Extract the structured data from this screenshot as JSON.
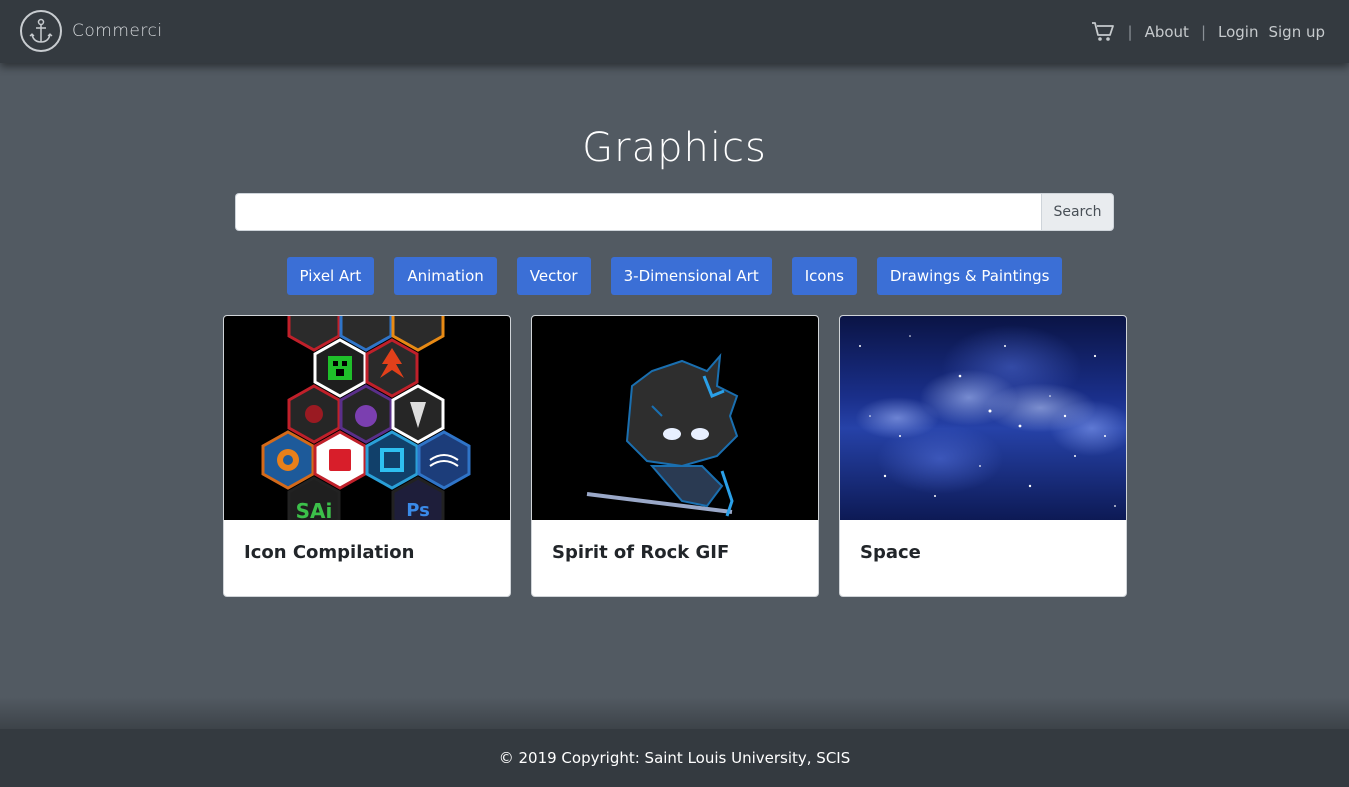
{
  "header": {
    "brand": "Commerci",
    "nav": {
      "about": "About",
      "login": "Login",
      "signup": "Sign up"
    },
    "separator": "|"
  },
  "main": {
    "title": "Graphics",
    "search": {
      "placeholder": "",
      "button_label": "Search"
    },
    "categories": [
      "Pixel Art",
      "Animation",
      "Vector",
      "3-Dimensional Art",
      "Icons",
      "Drawings & Paintings"
    ],
    "cards": [
      {
        "title": "Icon Compilation",
        "icon_texts": [
          "SAi",
          "Ps"
        ]
      },
      {
        "title": "Spirit of Rock GIF"
      },
      {
        "title": "Space"
      }
    ]
  },
  "footer": {
    "text": "© 2019 Copyright: Saint Louis University, SCIS"
  },
  "colors": {
    "navbar": "#343a40",
    "main_bg": "#525a62",
    "category_button": "#3b6fd6"
  }
}
